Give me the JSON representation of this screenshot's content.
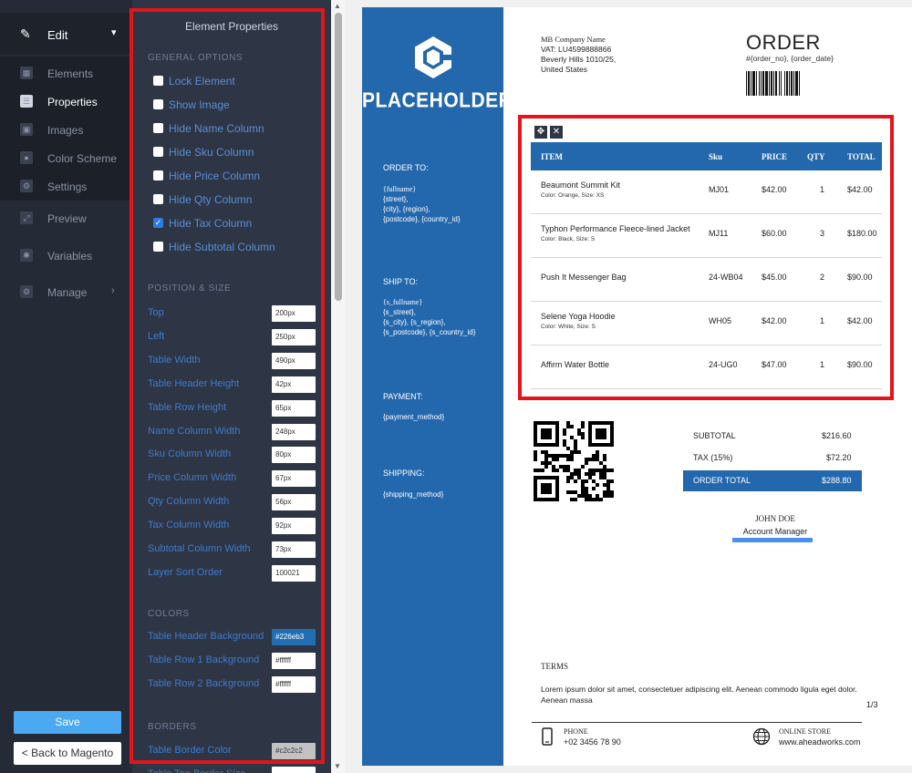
{
  "nav": {
    "edit": "Edit",
    "items": [
      "Elements",
      "Properties",
      "Images",
      "Color Scheme",
      "Settings",
      "Preview",
      "Variables",
      "Manage"
    ],
    "save": "Save",
    "back": "< Back to Magento"
  },
  "panel": {
    "title": "Element Properties",
    "general_title": "GENERAL OPTIONS",
    "checkboxes": [
      {
        "label": "Lock Element",
        "checked": false
      },
      {
        "label": "Show Image",
        "checked": false
      },
      {
        "label": "Hide Name Column",
        "checked": false
      },
      {
        "label": "Hide Sku Column",
        "checked": false
      },
      {
        "label": "Hide Price Column",
        "checked": false
      },
      {
        "label": "Hide Qty Column",
        "checked": false
      },
      {
        "label": "Hide Tax Column",
        "checked": true
      },
      {
        "label": "Hide Subtotal Column",
        "checked": false
      }
    ],
    "position_title": "POSITION & SIZE",
    "fields": [
      {
        "label": "Top",
        "value": "200px"
      },
      {
        "label": "Left",
        "value": "250px"
      },
      {
        "label": "Table Width",
        "value": "490px"
      },
      {
        "label": "Table Header Height",
        "value": "42px"
      },
      {
        "label": "Table Row Height",
        "value": "65px"
      },
      {
        "label": "Name Column Width",
        "value": "248px"
      },
      {
        "label": "Sku Column Width",
        "value": "80px"
      },
      {
        "label": "Price Column Width",
        "value": "67px"
      },
      {
        "label": "Qty Column Width",
        "value": "56px"
      },
      {
        "label": "Tax Column Width",
        "value": "92px"
      },
      {
        "label": "Subtotal Column Width",
        "value": "73px"
      },
      {
        "label": "Layer Sort Order",
        "value": "100021"
      }
    ],
    "colors_title": "COLORS",
    "colors": [
      {
        "label": "Table Header Background",
        "value": "#226eb3"
      },
      {
        "label": "Table Row 1 Background",
        "value": "#ffffff"
      },
      {
        "label": "Table Row 2 Background",
        "value": "#ffffff"
      }
    ],
    "borders_title": "BORDERS",
    "borders": [
      {
        "label": "Table Border Color",
        "value": "#c2c2c2"
      },
      {
        "label": "Table Top Border Size",
        "value": ""
      }
    ]
  },
  "doc": {
    "logo": "PLACEHOLDER",
    "order_to_h": "ORDER TO:",
    "order_to_name": "{fullname}",
    "order_to_addr": "{street},\n{city}, {region},\n{postcode}, {country_id}",
    "ship_to_h": "SHIP TO:",
    "ship_to_name": "{s_fullname}",
    "ship_to_addr": "{s_street},\n{s_city}, {s_region},\n{s_postcode}, {s_country_id}",
    "payment_h": "PAYMENT:",
    "payment_v": "{payment_method}",
    "shipping_h": "SHIPPING:",
    "shipping_v": "{shipping_method}",
    "company_name": "MB Company Name",
    "company_addr": "VAT: LU4599888866\nBeverly Hills 1010/25,\nUnited States",
    "order_title": "ORDER",
    "order_sub": "#{order_no}, {order_date}",
    "table": {
      "headers": [
        "ITEM",
        "Sku",
        "PRICE",
        "QTY",
        "TOTAL"
      ],
      "rows": [
        {
          "name": "Beaumont Summit Kit",
          "opt": "Color: Orange, Size: XS",
          "sku": "MJ01",
          "price": "$42.00",
          "qty": "1",
          "total": "$42.00"
        },
        {
          "name": "Typhon Performance Fleece-lined Jacket",
          "opt": "Color: Black, Size: S",
          "sku": "MJ11",
          "price": "$60.00",
          "qty": "3",
          "total": "$180.00"
        },
        {
          "name": "Push It Messenger Bag",
          "opt": "",
          "sku": "24-WB04",
          "price": "$45.00",
          "qty": "2",
          "total": "$90.00"
        },
        {
          "name": "Selene Yoga Hoodie",
          "opt": "Color: White, Size: S",
          "sku": "WH05",
          "price": "$42.00",
          "qty": "1",
          "total": "$42.00"
        },
        {
          "name": "Affirm Water Bottle",
          "opt": "",
          "sku": "24-UG0",
          "price": "$47.00",
          "qty": "1",
          "total": "$90.00"
        }
      ]
    },
    "subtotal_l": "SUBTOTAL",
    "subtotal_v": "$216.60",
    "tax_l": "TAX (15%)",
    "tax_v": "$72.20",
    "total_l": "ORDER TOTAL",
    "total_v": "$288.80",
    "sign_name": "JOHN DOE",
    "sign_role": "Account Manager",
    "terms_h": "TERMS",
    "terms_t": "Lorem ipsum dolor sit amet, consectetuer adipiscing elit. Aenean commodo ligula eget dolor. Aenean massa",
    "page": "1/3",
    "phone_l": "PHONE",
    "phone_v": "+02 3456 78 90",
    "store_l": "ONLINE STORE",
    "store_v": "www.aheadworks.com"
  }
}
